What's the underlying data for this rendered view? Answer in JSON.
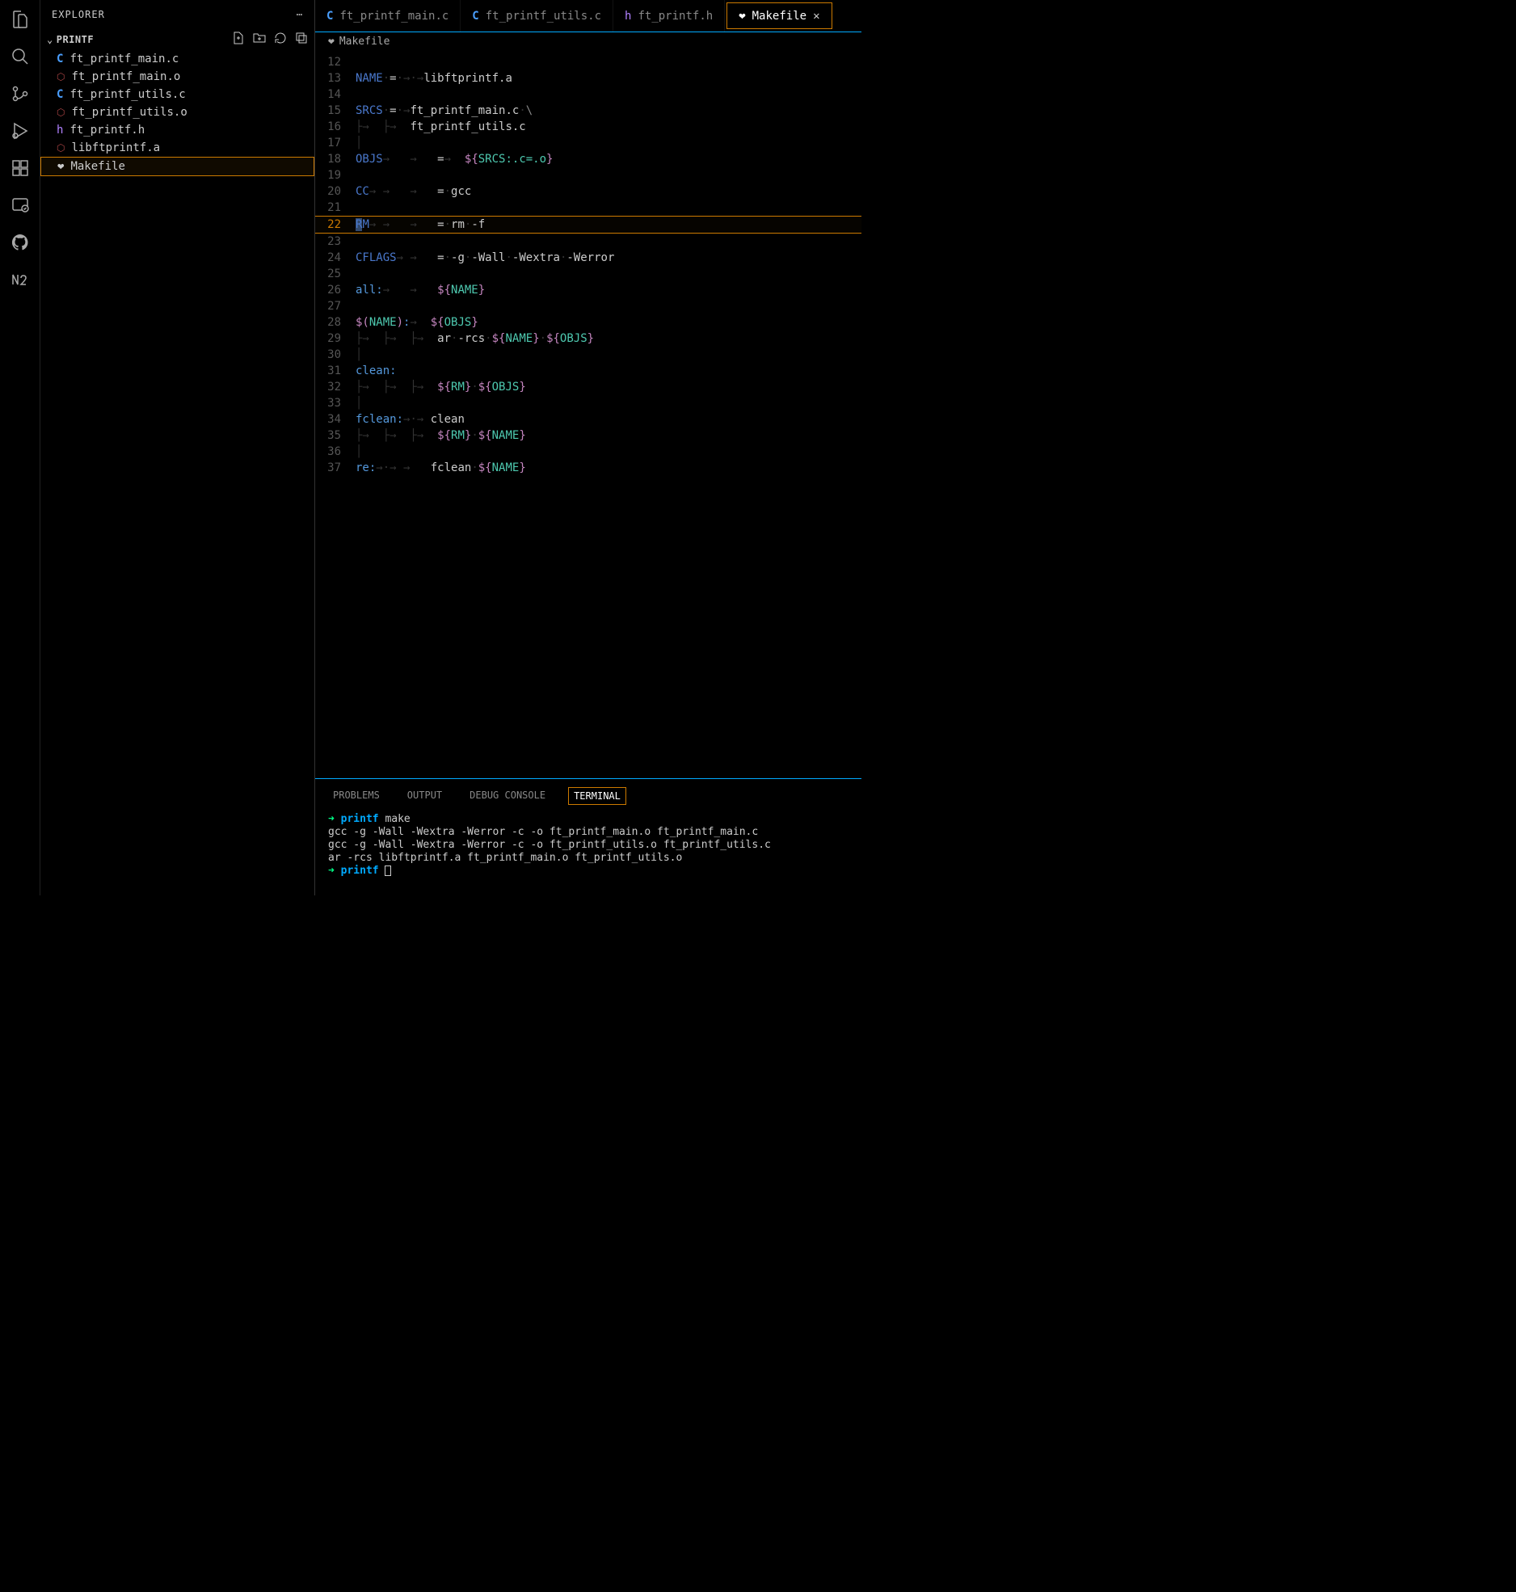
{
  "sidebar": {
    "title": "EXPLORER",
    "folder": "PRINTF",
    "files": [
      {
        "name": "ft_printf_main.c",
        "type": "c"
      },
      {
        "name": "ft_printf_main.o",
        "type": "o"
      },
      {
        "name": "ft_printf_utils.c",
        "type": "c"
      },
      {
        "name": "ft_printf_utils.o",
        "type": "o"
      },
      {
        "name": "ft_printf.h",
        "type": "h"
      },
      {
        "name": "libftprintf.a",
        "type": "a"
      },
      {
        "name": "Makefile",
        "type": "make",
        "selected": true
      }
    ]
  },
  "tabs": [
    {
      "label": "ft_printf_main.c",
      "icon": "c"
    },
    {
      "label": "ft_printf_utils.c",
      "icon": "c"
    },
    {
      "label": "ft_printf.h",
      "icon": "h"
    },
    {
      "label": "Makefile",
      "icon": "make",
      "active": true,
      "closeable": true
    }
  ],
  "breadcrumb": "Makefile",
  "editor": {
    "current_line": 22,
    "lines": [
      {
        "n": 12,
        "t": []
      },
      {
        "n": 13,
        "t": [
          {
            "c": "tok-key",
            "s": "NAME"
          },
          {
            "c": "tok-ws",
            "s": "·"
          },
          {
            "c": "tok-op",
            "s": "="
          },
          {
            "c": "tok-ws",
            "s": "·→·→"
          },
          {
            "c": "tok-str",
            "s": "libftprintf.a"
          }
        ]
      },
      {
        "n": 14,
        "t": []
      },
      {
        "n": 15,
        "t": [
          {
            "c": "tok-key",
            "s": "SRCS"
          },
          {
            "c": "tok-ws",
            "s": "·"
          },
          {
            "c": "tok-op",
            "s": "="
          },
          {
            "c": "tok-ws",
            "s": "·→"
          },
          {
            "c": "tok-str",
            "s": "ft_printf_main.c"
          },
          {
            "c": "tok-ws",
            "s": "·"
          },
          {
            "c": "tok-cont",
            "s": "\\"
          }
        ]
      },
      {
        "n": 16,
        "t": [
          {
            "c": "tok-indent",
            "s": "├→  ├→  "
          },
          {
            "c": "tok-str",
            "s": "ft_printf_utils.c"
          }
        ]
      },
      {
        "n": 17,
        "t": [
          {
            "c": "tok-indent",
            "s": "│"
          }
        ]
      },
      {
        "n": 18,
        "t": [
          {
            "c": "tok-key",
            "s": "OBJS"
          },
          {
            "c": "tok-ws",
            "s": "→   →   "
          },
          {
            "c": "tok-op",
            "s": "="
          },
          {
            "c": "tok-ws",
            "s": "→  "
          },
          {
            "c": "tok-brace",
            "s": "${"
          },
          {
            "c": "tok-name",
            "s": "SRCS:.c=.o"
          },
          {
            "c": "tok-brace",
            "s": "}"
          }
        ]
      },
      {
        "n": 19,
        "t": []
      },
      {
        "n": 20,
        "t": [
          {
            "c": "tok-key",
            "s": "CC"
          },
          {
            "c": "tok-ws",
            "s": "→ →   →   "
          },
          {
            "c": "tok-op",
            "s": "="
          },
          {
            "c": "tok-ws",
            "s": "·"
          },
          {
            "c": "tok-str",
            "s": "gcc"
          }
        ]
      },
      {
        "n": 21,
        "t": []
      },
      {
        "n": 22,
        "t": [
          {
            "c": "tok-key sel",
            "s": "R"
          },
          {
            "c": "tok-key",
            "s": "M"
          },
          {
            "c": "tok-ws",
            "s": "→ →   →   "
          },
          {
            "c": "tok-op",
            "s": "="
          },
          {
            "c": "tok-ws",
            "s": "·"
          },
          {
            "c": "tok-str",
            "s": "rm"
          },
          {
            "c": "tok-ws",
            "s": "·"
          },
          {
            "c": "tok-str",
            "s": "-f"
          }
        ]
      },
      {
        "n": 23,
        "t": []
      },
      {
        "n": 24,
        "t": [
          {
            "c": "tok-key",
            "s": "CFLAGS"
          },
          {
            "c": "tok-ws",
            "s": "→ →   "
          },
          {
            "c": "tok-op",
            "s": "="
          },
          {
            "c": "tok-ws",
            "s": "·"
          },
          {
            "c": "tok-str",
            "s": "-g"
          },
          {
            "c": "tok-ws",
            "s": "·"
          },
          {
            "c": "tok-str",
            "s": "-Wall"
          },
          {
            "c": "tok-ws",
            "s": "·"
          },
          {
            "c": "tok-str",
            "s": "-Wextra"
          },
          {
            "c": "tok-ws",
            "s": "·"
          },
          {
            "c": "tok-str",
            "s": "-Werror"
          }
        ]
      },
      {
        "n": 25,
        "t": []
      },
      {
        "n": 26,
        "t": [
          {
            "c": "tok-target",
            "s": "all:"
          },
          {
            "c": "tok-ws",
            "s": "→   →   "
          },
          {
            "c": "tok-brace",
            "s": "${"
          },
          {
            "c": "tok-name",
            "s": "NAME"
          },
          {
            "c": "tok-brace",
            "s": "}"
          }
        ]
      },
      {
        "n": 27,
        "t": []
      },
      {
        "n": 28,
        "t": [
          {
            "c": "tok-brace",
            "s": "$("
          },
          {
            "c": "tok-name",
            "s": "NAME"
          },
          {
            "c": "tok-brace",
            "s": ")"
          },
          {
            "c": "tok-target",
            "s": ":"
          },
          {
            "c": "tok-ws",
            "s": "→  "
          },
          {
            "c": "tok-brace",
            "s": "${"
          },
          {
            "c": "tok-name",
            "s": "OBJS"
          },
          {
            "c": "tok-brace",
            "s": "}"
          }
        ]
      },
      {
        "n": 29,
        "t": [
          {
            "c": "tok-indent",
            "s": "├→  ├→  ├→  "
          },
          {
            "c": "tok-str",
            "s": "ar"
          },
          {
            "c": "tok-ws",
            "s": "·"
          },
          {
            "c": "tok-str",
            "s": "-rcs"
          },
          {
            "c": "tok-ws",
            "s": "·"
          },
          {
            "c": "tok-brace",
            "s": "${"
          },
          {
            "c": "tok-name",
            "s": "NAME"
          },
          {
            "c": "tok-brace",
            "s": "}"
          },
          {
            "c": "tok-ws",
            "s": "·"
          },
          {
            "c": "tok-brace",
            "s": "${"
          },
          {
            "c": "tok-name",
            "s": "OBJS"
          },
          {
            "c": "tok-brace",
            "s": "}"
          }
        ]
      },
      {
        "n": 30,
        "t": [
          {
            "c": "tok-indent",
            "s": "│"
          }
        ]
      },
      {
        "n": 31,
        "t": [
          {
            "c": "tok-target",
            "s": "clean:"
          }
        ]
      },
      {
        "n": 32,
        "t": [
          {
            "c": "tok-indent",
            "s": "├→  ├→  ├→  "
          },
          {
            "c": "tok-brace",
            "s": "${"
          },
          {
            "c": "tok-name",
            "s": "RM"
          },
          {
            "c": "tok-brace",
            "s": "}"
          },
          {
            "c": "tok-ws",
            "s": "·"
          },
          {
            "c": "tok-brace",
            "s": "${"
          },
          {
            "c": "tok-name",
            "s": "OBJS"
          },
          {
            "c": "tok-brace",
            "s": "}"
          }
        ]
      },
      {
        "n": 33,
        "t": [
          {
            "c": "tok-indent",
            "s": "│"
          }
        ]
      },
      {
        "n": 34,
        "t": [
          {
            "c": "tok-target",
            "s": "fclean:"
          },
          {
            "c": "tok-ws",
            "s": "→·→ "
          },
          {
            "c": "tok-str",
            "s": "clean"
          }
        ]
      },
      {
        "n": 35,
        "t": [
          {
            "c": "tok-indent",
            "s": "├→  ├→  ├→  "
          },
          {
            "c": "tok-brace",
            "s": "${"
          },
          {
            "c": "tok-name",
            "s": "RM"
          },
          {
            "c": "tok-brace",
            "s": "}"
          },
          {
            "c": "tok-ws",
            "s": "·"
          },
          {
            "c": "tok-brace",
            "s": "${"
          },
          {
            "c": "tok-name",
            "s": "NAME"
          },
          {
            "c": "tok-brace",
            "s": "}"
          }
        ]
      },
      {
        "n": 36,
        "t": [
          {
            "c": "tok-indent",
            "s": "│"
          }
        ]
      },
      {
        "n": 37,
        "t": [
          {
            "c": "tok-target",
            "s": "re:"
          },
          {
            "c": "tok-ws",
            "s": "→·→ →   "
          },
          {
            "c": "tok-str",
            "s": "fclean"
          },
          {
            "c": "tok-ws",
            "s": "·"
          },
          {
            "c": "tok-brace",
            "s": "${"
          },
          {
            "c": "tok-name",
            "s": "NAME"
          },
          {
            "c": "tok-brace",
            "s": "}"
          }
        ]
      }
    ]
  },
  "panel": {
    "tabs": [
      "PROBLEMS",
      "OUTPUT",
      "DEBUG CONSOLE",
      "TERMINAL"
    ],
    "active_tab": "TERMINAL",
    "terminal_lines": [
      {
        "type": "prompt",
        "dir": "printf",
        "cmd": "make"
      },
      {
        "type": "out",
        "text": "gcc -g -Wall -Wextra -Werror   -c -o ft_printf_main.o ft_printf_main.c"
      },
      {
        "type": "out",
        "text": "gcc -g -Wall -Wextra -Werror   -c -o ft_printf_utils.o ft_printf_utils.c"
      },
      {
        "type": "out",
        "text": "ar -rcs libftprintf.a ft_printf_main.o ft_printf_utils.o"
      },
      {
        "type": "prompt",
        "dir": "printf",
        "cmd": ""
      }
    ]
  }
}
